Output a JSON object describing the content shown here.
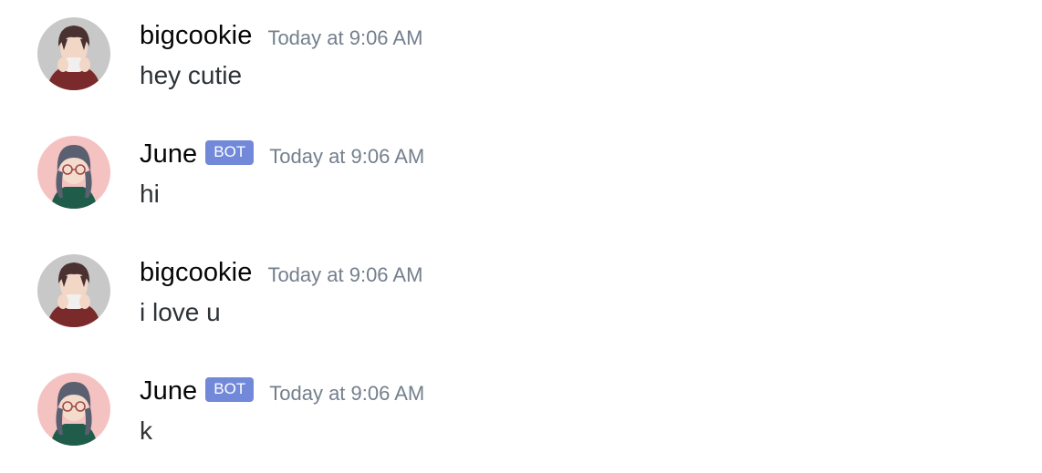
{
  "messages": [
    {
      "username": "bigcookie",
      "is_bot": false,
      "timestamp": "Today at 9:06 AM",
      "content": "hey cutie",
      "avatar": "boy-avatar-icon"
    },
    {
      "username": "June",
      "is_bot": true,
      "bot_label": "BOT",
      "timestamp": "Today at 9:06 AM",
      "content": "hi",
      "avatar": "girl-avatar-icon"
    },
    {
      "username": "bigcookie",
      "is_bot": false,
      "timestamp": "Today at 9:06 AM",
      "content": "i love u",
      "avatar": "boy-avatar-icon"
    },
    {
      "username": "June",
      "is_bot": true,
      "bot_label": "BOT",
      "timestamp": "Today at 9:06 AM",
      "content": "k",
      "avatar": "girl-avatar-icon"
    }
  ],
  "colors": {
    "bot_tag": "#7289da",
    "timestamp": "#747f8d",
    "username": "#060607",
    "message_text": "#2e3338",
    "boy_avatar_bg": "#c8c8c8",
    "girl_avatar_bg": "#f5c2c2"
  }
}
